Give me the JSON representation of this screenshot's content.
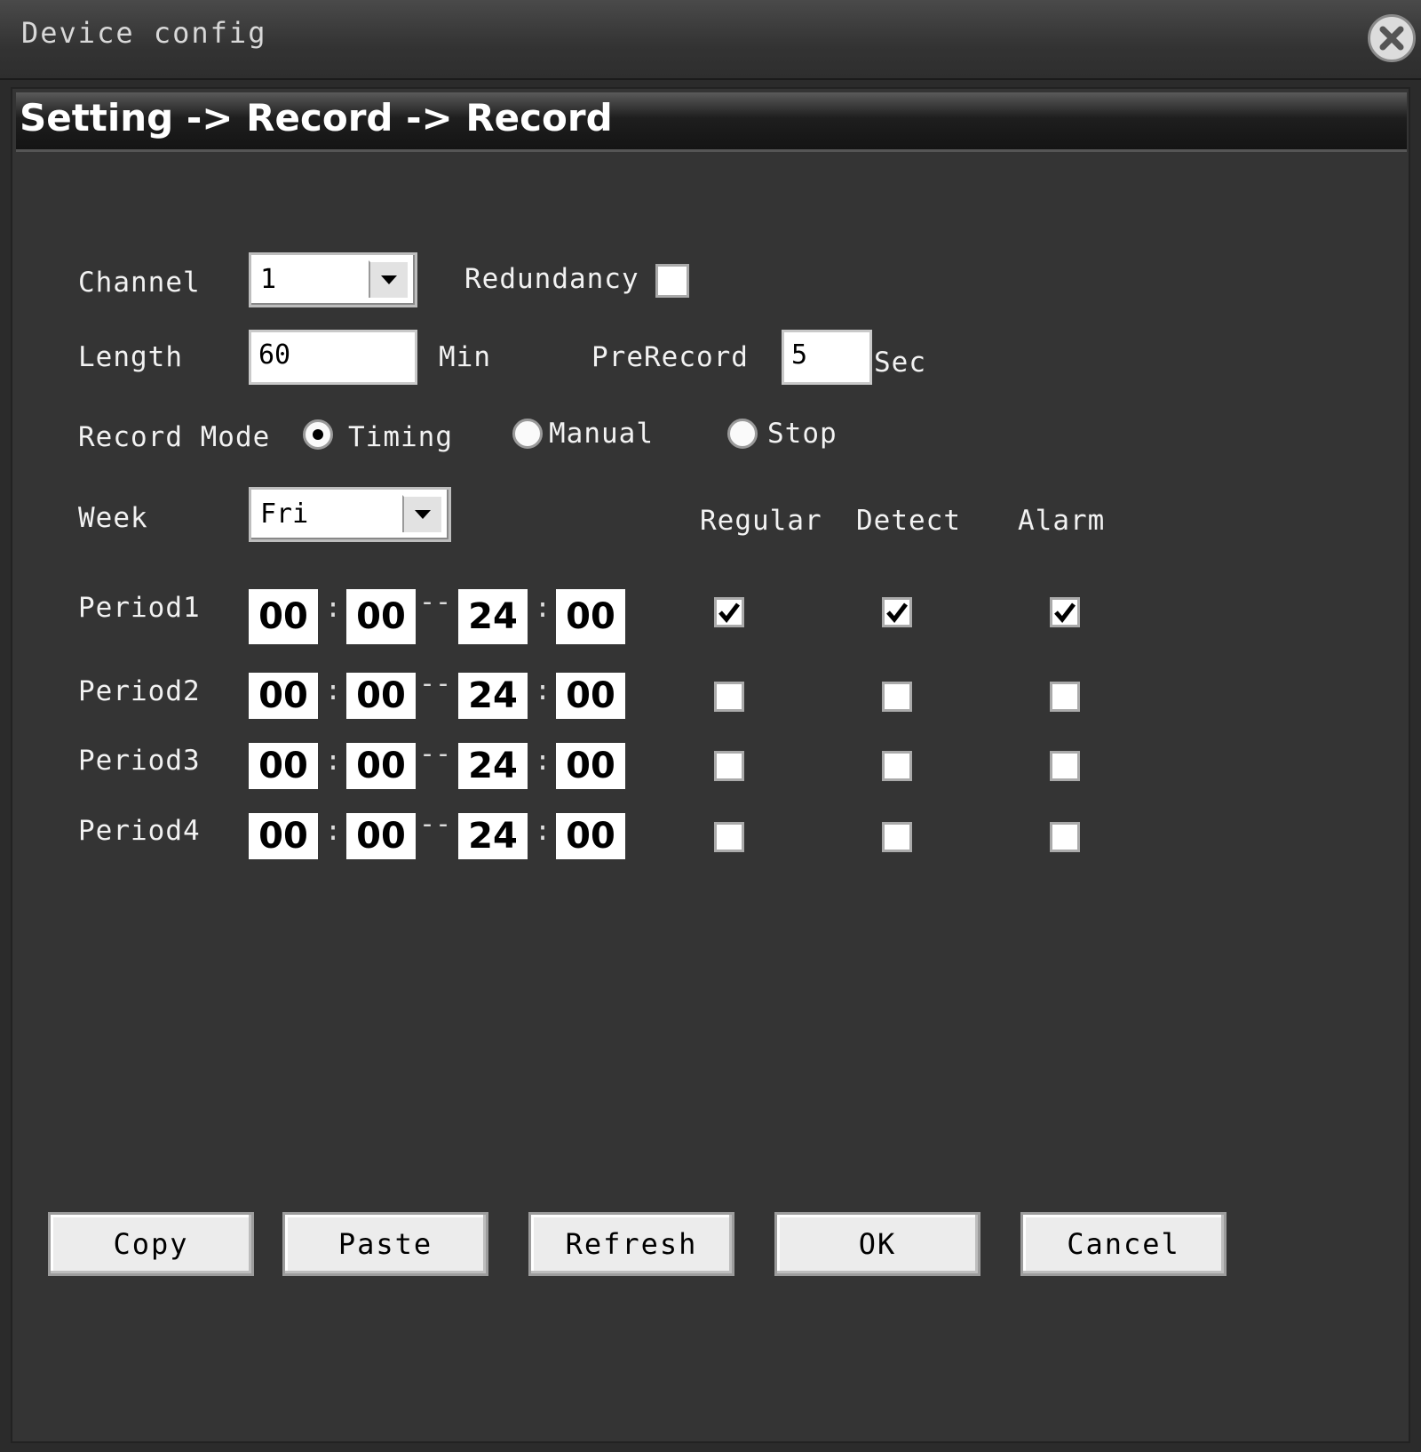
{
  "window": {
    "title": "Device config",
    "close_icon": "close-icon"
  },
  "breadcrumb": "Setting -> Record -> Record",
  "channel": {
    "label": "Channel",
    "value": "1"
  },
  "redundancy": {
    "label": "Redundancy",
    "checked": false
  },
  "length": {
    "label": "Length",
    "value": "60",
    "unit": "Min"
  },
  "prerecord": {
    "label": "PreRecord",
    "value": "5",
    "unit": "Sec"
  },
  "record_mode": {
    "label": "Record Mode",
    "options": [
      "Timing",
      "Manual",
      "Stop"
    ],
    "selected": "Timing"
  },
  "week": {
    "label": "Week",
    "value": "Fri"
  },
  "columns": [
    "Regular",
    "Detect",
    "Alarm"
  ],
  "periods": [
    {
      "label": "Period1",
      "start_h": "00",
      "start_m": "00",
      "end_h": "24",
      "end_m": "00",
      "regular": true,
      "detect": true,
      "alarm": true
    },
    {
      "label": "Period2",
      "start_h": "00",
      "start_m": "00",
      "end_h": "24",
      "end_m": "00",
      "regular": false,
      "detect": false,
      "alarm": false
    },
    {
      "label": "Period3",
      "start_h": "00",
      "start_m": "00",
      "end_h": "24",
      "end_m": "00",
      "regular": false,
      "detect": false,
      "alarm": false
    },
    {
      "label": "Period4",
      "start_h": "00",
      "start_m": "00",
      "end_h": "24",
      "end_m": "00",
      "regular": false,
      "detect": false,
      "alarm": false
    }
  ],
  "time_colon": ":",
  "time_dash": "--",
  "buttons": {
    "copy": "Copy",
    "paste": "Paste",
    "refresh": "Refresh",
    "ok": "OK",
    "cancel": "Cancel"
  }
}
